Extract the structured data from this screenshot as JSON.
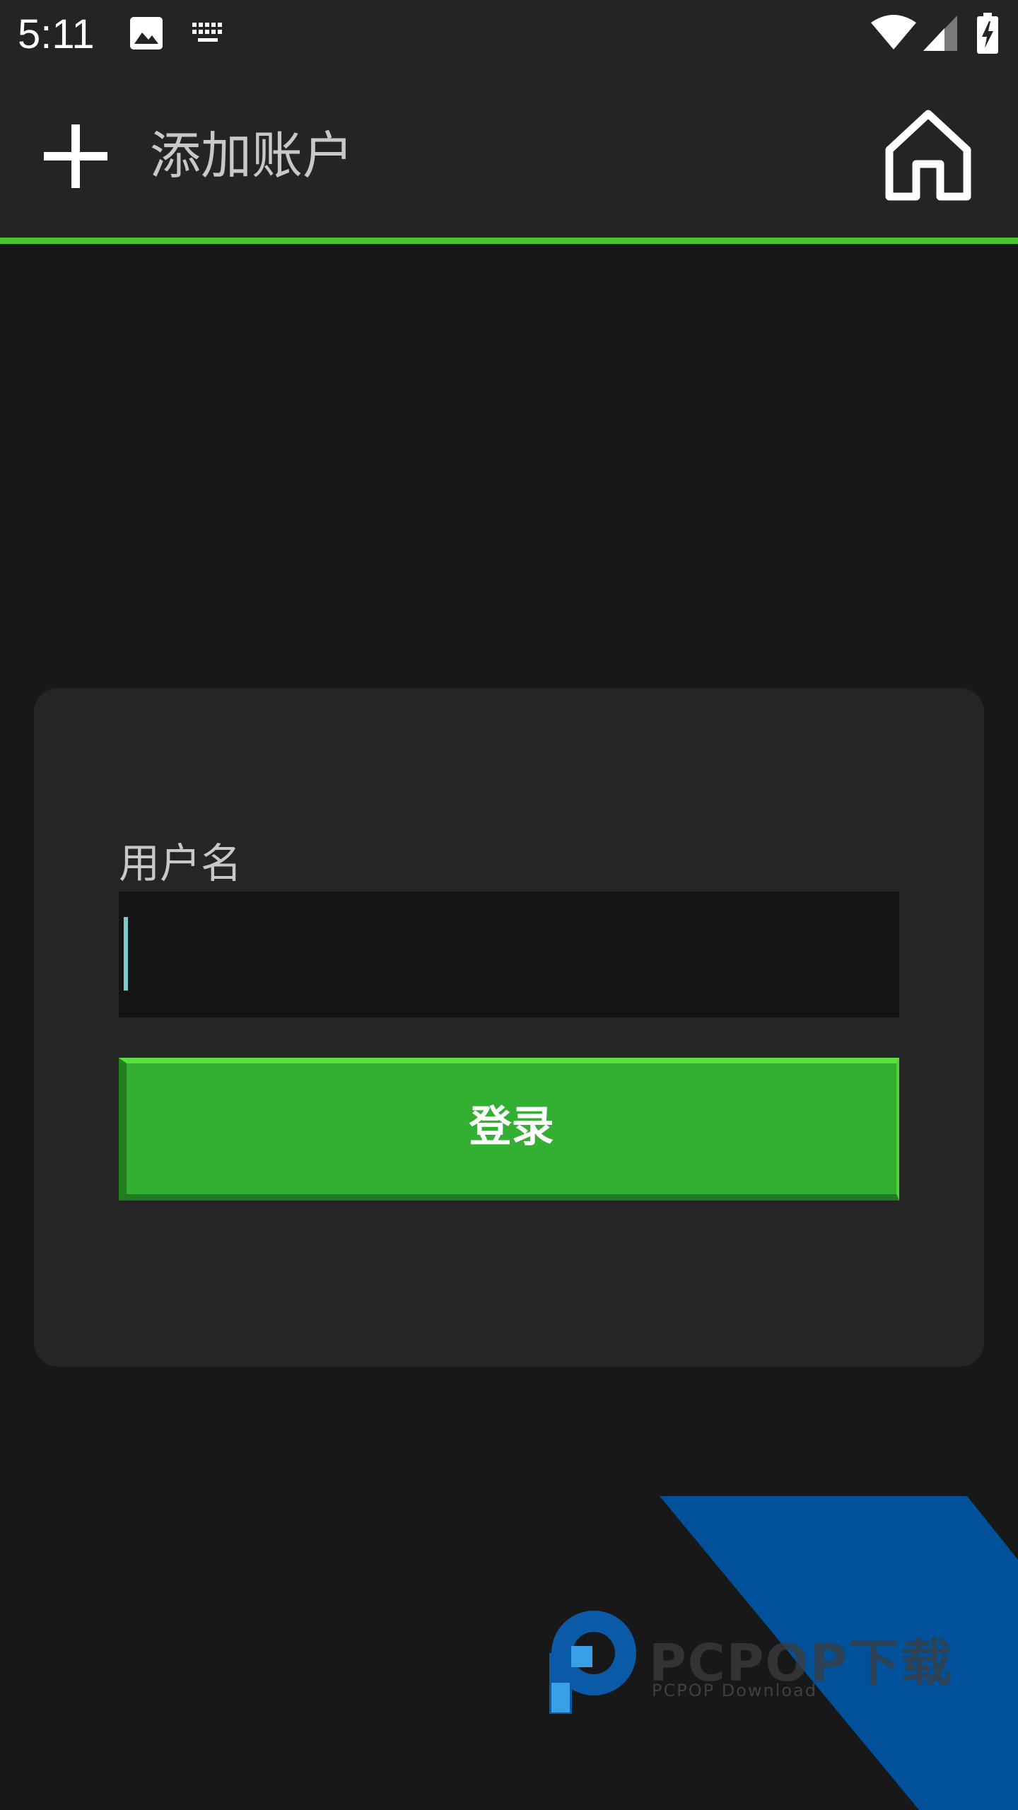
{
  "status_bar": {
    "time": "5:11",
    "icons": [
      "image-icon",
      "keyboard-icon",
      "wifi-icon",
      "signal-icon",
      "battery-charging-icon"
    ]
  },
  "app_bar": {
    "title": "添加账户",
    "left_icon": "add-icon",
    "right_icon": "home-icon"
  },
  "login_form": {
    "username_label": "用户名",
    "username_value": "",
    "login_button_label": "登录"
  },
  "watermark": {
    "brand": "PCPOP下载",
    "subtitle": "PCPOP Download"
  },
  "colors": {
    "background": "#181818",
    "app_bar": "#242424",
    "accent": "#49c82e",
    "card": "#252525",
    "input": "#141414",
    "button": "#33b032",
    "watermark_blue": "#00519a"
  }
}
